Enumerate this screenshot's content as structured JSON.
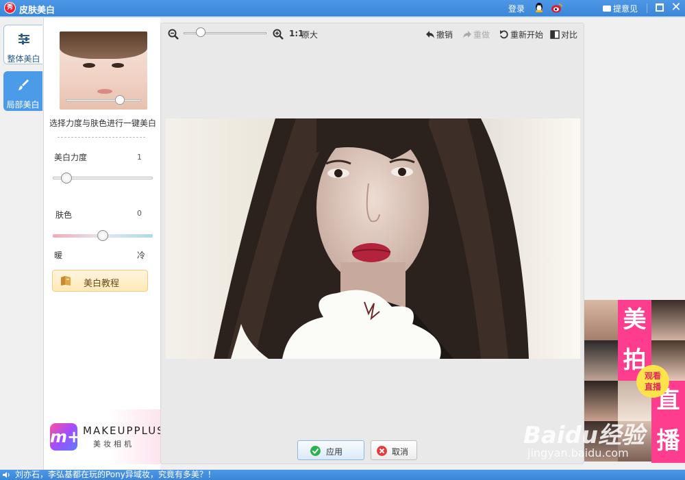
{
  "titlebar": {
    "logo_text": "秀",
    "title": "皮肤美白",
    "login": "登录",
    "feedback": "提意见"
  },
  "tabs": [
    {
      "label": "整体美白",
      "active": true,
      "icon": "sliders-icon"
    },
    {
      "label": "局部美白",
      "active": false,
      "icon": "brush-icon"
    }
  ],
  "left_panel": {
    "description": "选择力度与肤色进行一键美白",
    "strength_label": "美白力度",
    "strength_value": "1",
    "skin_label": "肤色",
    "skin_value": "0",
    "warm_label": "暖",
    "cool_label": "冷",
    "tutorial_button": "美白教程",
    "preview_slider_fraction": 0.8,
    "strength_fraction": 0.1,
    "skin_fraction": 0.5
  },
  "ad_makeupplus": {
    "logo": "m+",
    "name": "MAKEUPPLUS",
    "subtitle": "美妆相机"
  },
  "toolbar": {
    "zoom_fraction": 0.2,
    "ratio": "1:1",
    "original": "原大",
    "undo": "撤销",
    "redo": "重做",
    "reset": "重新开始",
    "compare": "对比"
  },
  "actions": {
    "apply": "应用",
    "cancel": "取消"
  },
  "right_ad": {
    "chars": [
      "美",
      "拍",
      "直",
      "播"
    ],
    "live_badge_line1": "观看",
    "live_badge_line2": "直播"
  },
  "watermark": {
    "text": "Baidu经验",
    "url": "jingyan.baidu.com"
  },
  "statusbar": {
    "news": "刘亦石，李弘基都在玩的Pony异域妆，究竟有多美？！"
  },
  "colors": {
    "titlebar": "#4d97e6",
    "accent_pink": "#ff3d8f",
    "apply_check": "#2bb24c",
    "cancel_x": "#e8393f"
  }
}
